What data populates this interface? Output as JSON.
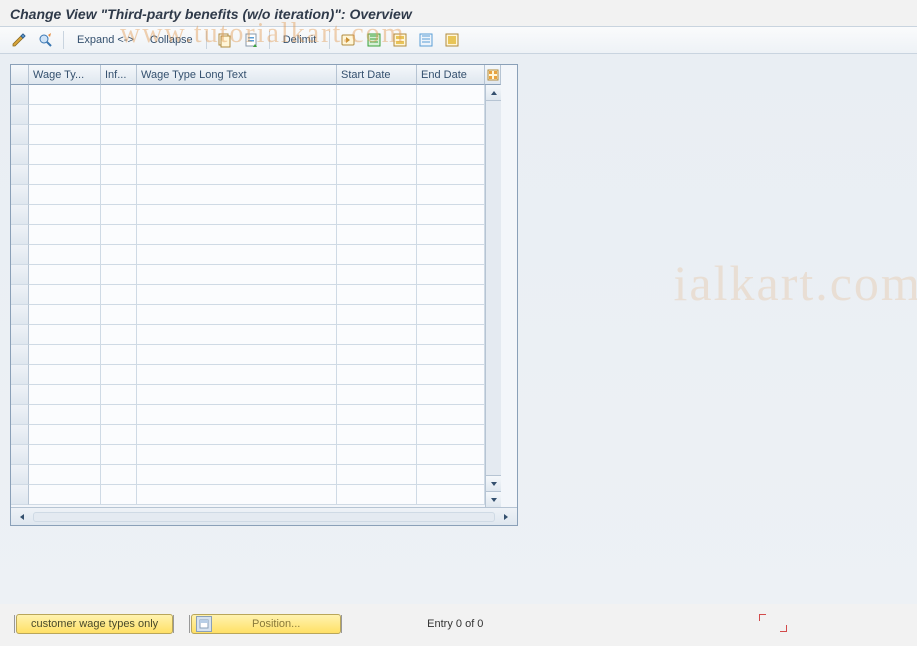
{
  "header": {
    "title": "Change View \"Third-party benefits (w/o iteration)\": Overview"
  },
  "toolbar": {
    "expand_label": "Expand <->",
    "collapse_label": "Collapse",
    "delimit_label": "Delimit"
  },
  "table": {
    "columns": [
      {
        "label": ""
      },
      {
        "label": "Wage Ty..."
      },
      {
        "label": "Inf..."
      },
      {
        "label": "Wage Type Long Text"
      },
      {
        "label": "Start Date"
      },
      {
        "label": "End Date"
      }
    ],
    "rows": []
  },
  "footer": {
    "customer_btn_label": "customer wage types only",
    "position_btn_label": "Position...",
    "entry_text": "Entry 0 of 0"
  },
  "watermark": {
    "line1": "www.tutorialkart.com",
    "line2": "ialkart.com"
  }
}
